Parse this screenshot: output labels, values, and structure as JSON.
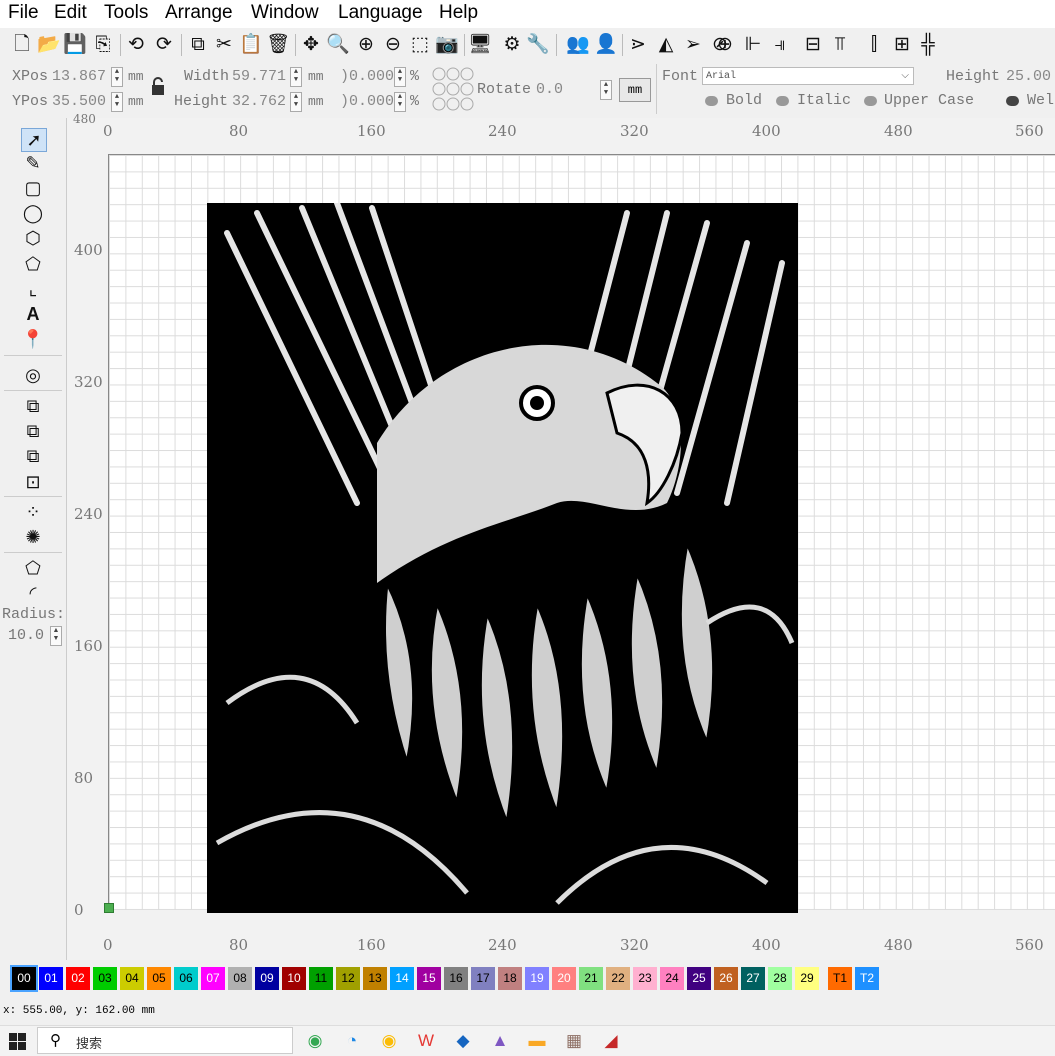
{
  "menu": [
    "File",
    "Edit",
    "Tools",
    "Arrange",
    "Window",
    "Language",
    "Help"
  ],
  "toolbar_icons": [
    "new-file",
    "open-folder",
    "save",
    "save-as",
    "undo",
    "redo",
    "copy",
    "cut",
    "paste",
    "delete",
    "move",
    "zoom",
    "zoom-in",
    "zoom-out",
    "zoom-selection",
    "camera",
    "monitor",
    "settings",
    "tools",
    "users",
    "user",
    "vectorize",
    "mirror",
    "send",
    "measure",
    "target",
    "align-left",
    "align-right",
    "align-top",
    "align-bottom",
    "distribute",
    "center"
  ],
  "props": {
    "xpos_label": "XPos",
    "xpos_value": "13.867",
    "ypos_label": "YPos",
    "ypos_value": "35.500",
    "width_label": "Width",
    "width_value": "59.771",
    "height_label": "Height",
    "height_value": "32.762",
    "unit": "mm",
    "scale_x": ")0.000",
    "scale_y": ")0.000",
    "percent": "%",
    "rotate_label": "Rotate",
    "rotate_value": "0.0",
    "mm_button": "mm",
    "font_label": "Font",
    "font_value": "Arial",
    "text_height_label": "Height",
    "text_height_value": "25.00",
    "bold": "Bold",
    "italic": "Italic",
    "upper": "Upper Case",
    "weld": "Wel"
  },
  "left_tools": [
    "select-arrow",
    "pencil",
    "rectangle",
    "ellipse",
    "hexagon",
    "polygon",
    "corner-frame",
    "text",
    "location-pin",
    "offset-ring",
    "boolean-union",
    "boolean-subtract",
    "boolean-intersect",
    "boolean-xor",
    "array-grid",
    "rotary-array",
    "node-edit",
    "corner-round"
  ],
  "radius": {
    "label": "Radius:",
    "value": "10.0"
  },
  "ruler": {
    "top_partial": "480",
    "h_ticks": [
      "0",
      "80",
      "160",
      "240",
      "320",
      "400",
      "480",
      "560"
    ],
    "v_ticks": [
      "400",
      "320",
      "240",
      "160",
      "80",
      "0"
    ]
  },
  "palette": [
    {
      "l": "00",
      "c": "#000000",
      "t": "#ffffff"
    },
    {
      "l": "01",
      "c": "#0000ff",
      "t": "#ffffff"
    },
    {
      "l": "02",
      "c": "#ff0000",
      "t": "#ffffff"
    },
    {
      "l": "03",
      "c": "#00cc00",
      "t": "#000000"
    },
    {
      "l": "04",
      "c": "#cccc00",
      "t": "#000000"
    },
    {
      "l": "05",
      "c": "#ff8800",
      "t": "#000000"
    },
    {
      "l": "06",
      "c": "#00cccc",
      "t": "#000000"
    },
    {
      "l": "07",
      "c": "#ff00ff",
      "t": "#ffffff"
    },
    {
      "l": "08",
      "c": "#b0b0b0",
      "t": "#000000"
    },
    {
      "l": "09",
      "c": "#0000a0",
      "t": "#ffffff"
    },
    {
      "l": "10",
      "c": "#a00000",
      "t": "#ffffff"
    },
    {
      "l": "11",
      "c": "#00a000",
      "t": "#000000"
    },
    {
      "l": "12",
      "c": "#a0a000",
      "t": "#000000"
    },
    {
      "l": "13",
      "c": "#c08000",
      "t": "#000000"
    },
    {
      "l": "14",
      "c": "#00a0ff",
      "t": "#ffffff"
    },
    {
      "l": "15",
      "c": "#a000a0",
      "t": "#ffffff"
    },
    {
      "l": "16",
      "c": "#808080",
      "t": "#000000"
    },
    {
      "l": "17",
      "c": "#8080c0",
      "t": "#000000"
    },
    {
      "l": "18",
      "c": "#c08080",
      "t": "#000000"
    },
    {
      "l": "19",
      "c": "#8080ff",
      "t": "#ffffff"
    },
    {
      "l": "20",
      "c": "#ff8080",
      "t": "#ffffff"
    },
    {
      "l": "21",
      "c": "#80e080",
      "t": "#000000"
    },
    {
      "l": "22",
      "c": "#e0b080",
      "t": "#000000"
    },
    {
      "l": "23",
      "c": "#ffb0d0",
      "t": "#000000"
    },
    {
      "l": "24",
      "c": "#ff80c0",
      "t": "#000000"
    },
    {
      "l": "25",
      "c": "#400080",
      "t": "#ffffff"
    },
    {
      "l": "26",
      "c": "#c06020",
      "t": "#ffffff"
    },
    {
      "l": "27",
      "c": "#006060",
      "t": "#ffffff"
    },
    {
      "l": "28",
      "c": "#a0ffa0",
      "t": "#000000"
    },
    {
      "l": "29",
      "c": "#ffff80",
      "t": "#000000"
    },
    {
      "l": "T1",
      "c": "#ff6a00",
      "t": "#000000"
    },
    {
      "l": "T2",
      "c": "#1e90ff",
      "t": "#ffffff"
    }
  ],
  "status": "x: 555.00, y: 162.00 mm",
  "taskbar": {
    "search_placeholder": "搜索",
    "apps": [
      "chrome",
      "edge",
      "chrome-alt",
      "wps",
      "app-blue",
      "photos",
      "file-explorer",
      "winrar",
      "lightburn"
    ]
  }
}
